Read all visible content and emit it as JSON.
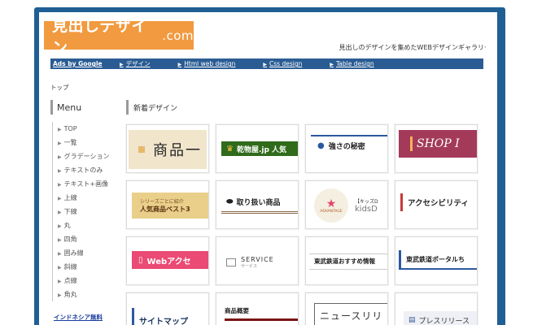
{
  "header": {
    "logo_main": "見出しデザイン",
    "logo_suffix": ".com",
    "tagline": "見出しのデザインを集めたWEBデザインギャラリー"
  },
  "nav": {
    "ads": "Ads by Google",
    "items": [
      {
        "label": "デザイン"
      },
      {
        "label": "Html web design"
      },
      {
        "label": "Css design"
      },
      {
        "label": "Table design"
      }
    ]
  },
  "breadcrumb": "トップ",
  "sidebar": {
    "heading": "Menu",
    "items": [
      {
        "label": "TOP"
      },
      {
        "label": "一覧"
      },
      {
        "label": "グラデーション"
      },
      {
        "label": "テキストのみ"
      },
      {
        "label": "テキスト+画像"
      },
      {
        "label": "上線"
      },
      {
        "label": "下線"
      },
      {
        "label": "丸"
      },
      {
        "label": "四角"
      },
      {
        "label": "囲み線"
      },
      {
        "label": "斜線"
      },
      {
        "label": "点線"
      },
      {
        "label": "角丸"
      }
    ],
    "ad_link": "インドネシア無料"
  },
  "main": {
    "heading": "新着デザイン",
    "cards": {
      "c11": {
        "text": "商品一"
      },
      "c12": {
        "text": "乾物屋.jp 人気"
      },
      "c13": {
        "text": "強さの秘密"
      },
      "c14": {
        "text": "SHOP I"
      },
      "c21": {
        "small": "シリーズごとに紹介",
        "text": "人気商品ベスト3"
      },
      "c22": {
        "text": "取り扱い商品"
      },
      "c23": {
        "advantage": "ADVANTAGE",
        "kicker": "【キッズD",
        "text": "kidsD"
      },
      "c24": {
        "text": "アクセシビリティ"
      },
      "c31": {
        "text": "Webアクセ"
      },
      "c32": {
        "text": "SERVICE",
        "sub": "サービス"
      },
      "c33": {
        "text": "東武鉄道おすすめ情報"
      },
      "c34": {
        "text": "東武鉄道ポータルち"
      },
      "c41": {
        "text": "サイトマップ"
      },
      "c42": {
        "text": "商品概要"
      },
      "c43": {
        "text": "ニュースリリ"
      },
      "c44": {
        "text": "プレスリリース"
      }
    }
  },
  "colors": {
    "frame": "#1f5f94",
    "logo_bg": "#f19a3f",
    "nav_bg": "#2a5c93"
  }
}
